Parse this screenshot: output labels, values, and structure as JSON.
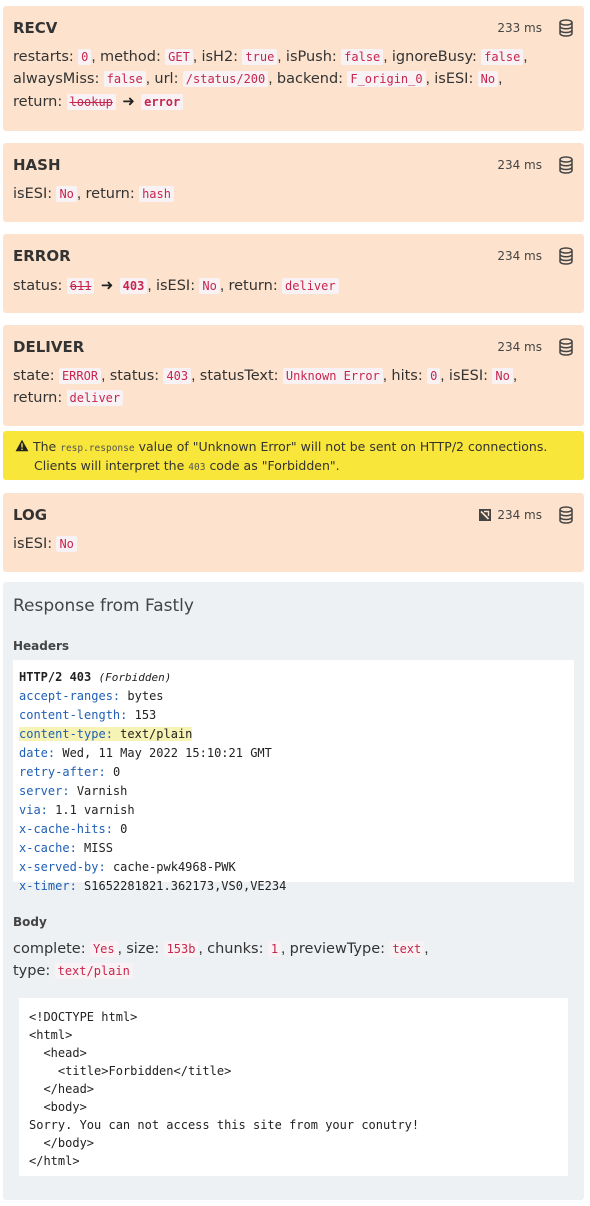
{
  "cards": {
    "recv": {
      "title": "RECV",
      "time": "233 ms",
      "restarts_k": "restarts:",
      "restarts_v": "0",
      "method_k": "method:",
      "method_v": "GET",
      "ish2_k": "isH2:",
      "ish2_v": "true",
      "ispush_k": "isPush:",
      "ispush_v": "false",
      "ignorebusy_k": "ignoreBusy:",
      "ignorebusy_v": "false",
      "alwaysmiss_k": "alwaysMiss:",
      "alwaysmiss_v": "false",
      "url_k": "url:",
      "url_v": "/status/200",
      "backend_k": "backend:",
      "backend_v": "F_origin_0",
      "isesi_k": "isESI:",
      "isesi_v": "No",
      "return_k": "return:",
      "return_old": "lookup",
      "return_new": "error"
    },
    "hash": {
      "title": "HASH",
      "time": "234 ms",
      "isesi_k": "isESI:",
      "isesi_v": "No",
      "return_k": "return:",
      "return_v": "hash"
    },
    "error": {
      "title": "ERROR",
      "time": "234 ms",
      "status_k": "status:",
      "status_old": "611",
      "status_new": "403",
      "isesi_k": "isESI:",
      "isesi_v": "No",
      "return_k": "return:",
      "return_v": "deliver"
    },
    "deliver": {
      "title": "DELIVER",
      "time": "234 ms",
      "state_k": "state:",
      "state_v": "ERROR",
      "status_k": "status:",
      "status_v": "403",
      "statustext_k": "statusText:",
      "statustext_v": "Unknown Error",
      "hits_k": "hits:",
      "hits_v": "0",
      "isesi_k": "isESI:",
      "isesi_v": "No",
      "return_k": "return:",
      "return_v": "deliver"
    },
    "log": {
      "title": "LOG",
      "time": "234 ms",
      "isesi_k": "isESI:",
      "isesi_v": "No"
    }
  },
  "warning": {
    "part1": "The",
    "code1": "resp.response",
    "part2": "value of \"Unknown Error\" will not be sent on HTTP/2 connections.",
    "part3": "Clients will interpret the",
    "code2": "403",
    "part4": "code as \"Forbidden\"."
  },
  "response": {
    "title": "Response from Fastly",
    "headers_label": "Headers",
    "status_line": "HTTP/2 403",
    "status_text": "(Forbidden)",
    "headers": [
      {
        "k": "accept-ranges:",
        "v": "bytes"
      },
      {
        "k": "content-length:",
        "v": "153"
      },
      {
        "k": "content-type:",
        "v": "text/plain"
      },
      {
        "k": "date:",
        "v": "Wed, 11 May 2022 15:10:21 GMT"
      },
      {
        "k": "retry-after:",
        "v": "0"
      },
      {
        "k": "server:",
        "v": "Varnish"
      },
      {
        "k": "via:",
        "v": "1.1 varnish"
      },
      {
        "k": "x-cache-hits:",
        "v": "0"
      },
      {
        "k": "x-cache:",
        "v": "MISS"
      },
      {
        "k": "x-served-by:",
        "v": "cache-pwk4968-PWK"
      },
      {
        "k": "x-timer:",
        "v": "S1652281821.362173,VS0,VE234"
      }
    ],
    "body_label": "Body",
    "complete_k": "complete:",
    "complete_v": "Yes",
    "size_k": "size:",
    "size_v": "153b",
    "chunks_k": "chunks:",
    "chunks_v": "1",
    "previewtype_k": "previewType:",
    "previewtype_v": "text",
    "type_k": "type:",
    "type_v": "text/plain",
    "body_text": "<!DOCTYPE html>\n<html>\n  <head>\n    <title>Forbidden</title>\n  </head>\n  <body>\nSorry. You can not access this site from your conutry!\n  </body>\n</html>"
  }
}
